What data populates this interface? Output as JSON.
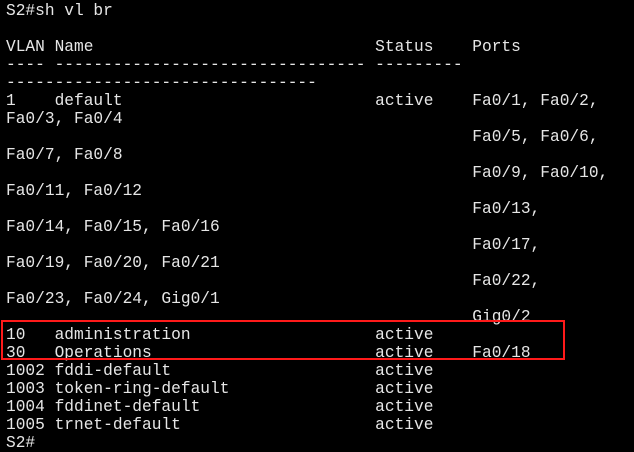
{
  "terminal": {
    "lines": [
      "S2#sh vl br",
      "",
      "VLAN Name                             Status    Ports",
      "---- -------------------------------- ---------",
      "--------------------------------",
      "1    default                          active    Fa0/1, Fa0/2,",
      "Fa0/3, Fa0/4",
      "                                                Fa0/5, Fa0/6,",
      "Fa0/7, Fa0/8",
      "                                                Fa0/9, Fa0/10,",
      "Fa0/11, Fa0/12",
      "                                                Fa0/13,",
      "Fa0/14, Fa0/15, Fa0/16",
      "                                                Fa0/17,",
      "Fa0/19, Fa0/20, Fa0/21",
      "                                                Fa0/22,",
      "Fa0/23, Fa0/24, Gig0/1",
      "                                                Gig0/2",
      "10   administration                   active",
      "30   Operations                       active    Fa0/18",
      "1002 fddi-default                     active",
      "1003 token-ring-default               active",
      "1004 fddinet-default                  active",
      "1005 trnet-default                    active",
      "S2#"
    ],
    "highlight_color": "#ff1a1a",
    "text_color": "#e6e6e6",
    "background_color": "#000000"
  }
}
